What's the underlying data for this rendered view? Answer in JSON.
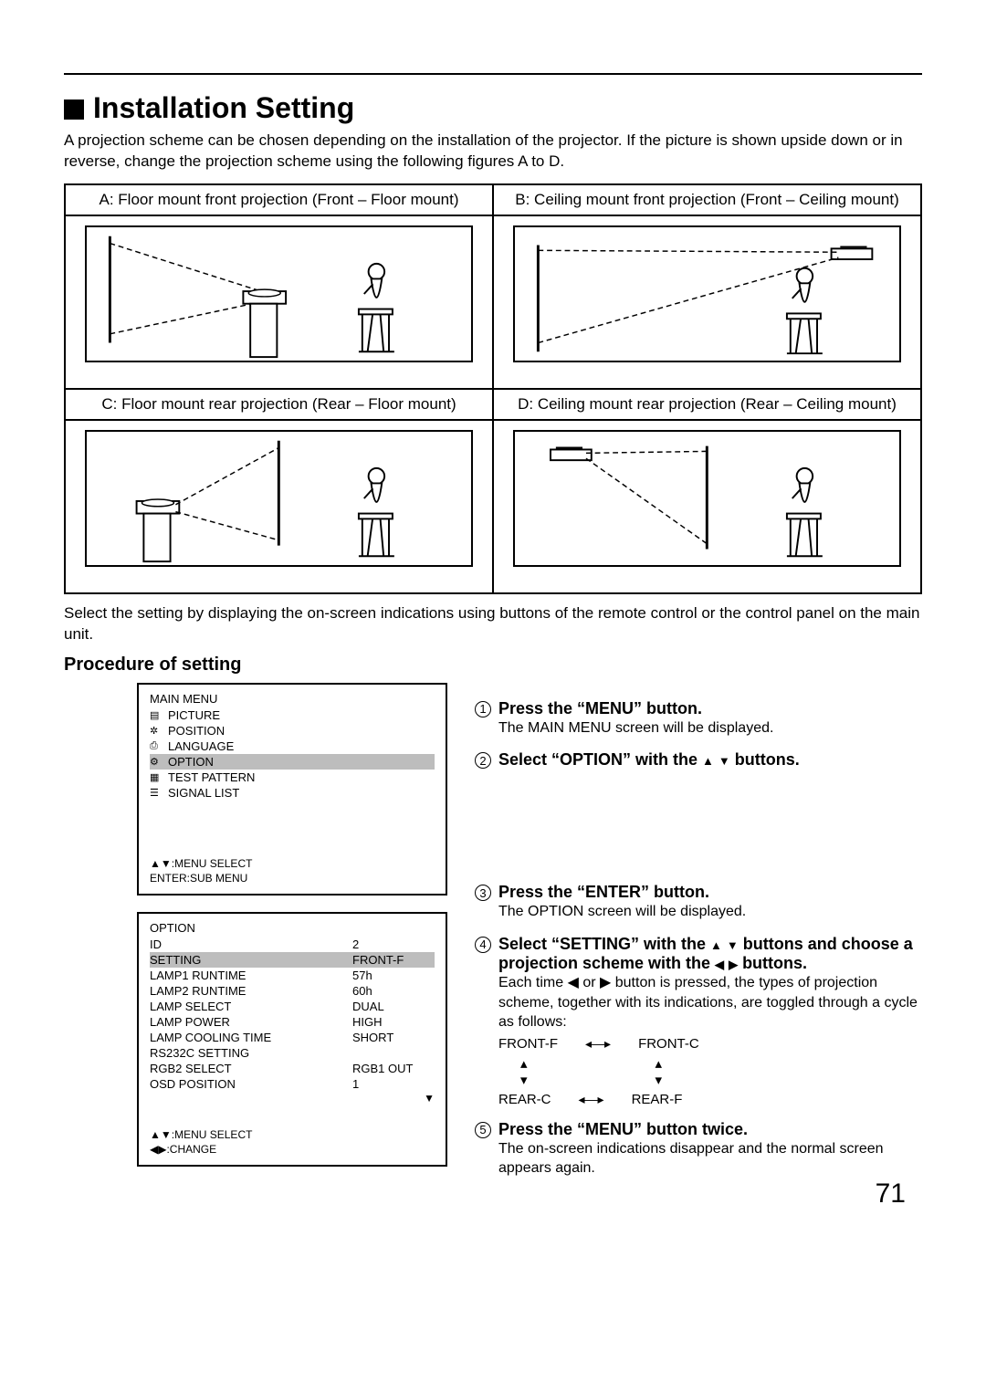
{
  "title": "Installation Setting",
  "intro": "A projection scheme can be chosen depending on the installation of the projector. If the picture is shown upside down or in reverse, change the projection scheme using the following figures A to D.",
  "schemes": {
    "a": "A: Floor mount front projection (Front – Floor mount)",
    "b": "B: Ceiling mount front projection (Front – Ceiling mount)",
    "c": "C: Floor mount rear projection (Rear – Floor mount)",
    "d": "D: Ceiling mount rear projection (Rear – Ceiling mount)"
  },
  "mid_text": "Select the setting by displaying the on-screen indications using buttons of the remote control or the control panel on the main unit.",
  "procedure_heading": "Procedure of setting",
  "osd1": {
    "title": "MAIN MENU",
    "items": [
      "PICTURE",
      "POSITION",
      "LANGUAGE",
      "OPTION",
      "TEST PATTERN",
      "SIGNAL LIST"
    ],
    "selected_index": 3,
    "foot1": "▲▼:MENU SELECT",
    "foot2": "ENTER:SUB MENU"
  },
  "osd2": {
    "title": "OPTION",
    "rows": [
      {
        "label": "ID",
        "value": "2"
      },
      {
        "label": "SETTING",
        "value": "FRONT-F",
        "sel": true
      },
      {
        "label": "LAMP1 RUNTIME",
        "value": "57h"
      },
      {
        "label": "LAMP2 RUNTIME",
        "value": "60h"
      },
      {
        "label": "LAMP SELECT",
        "value": "DUAL"
      },
      {
        "label": "LAMP POWER",
        "value": "HIGH"
      },
      {
        "label": "LAMP COOLING TIME",
        "value": "SHORT"
      },
      {
        "label": "RS232C SETTING",
        "value": ""
      },
      {
        "label": "RGB2 SELECT",
        "value": "RGB1 OUT"
      },
      {
        "label": "OSD POSITION",
        "value": "1"
      }
    ],
    "foot1": "▲▼:MENU SELECT",
    "foot2": "◀▶:CHANGE"
  },
  "steps": {
    "s1_head": "Press the “MENU” button.",
    "s1_body": "The MAIN MENU screen will be displayed.",
    "s2_head_a": "Select “OPTION” with the ",
    "s2_head_b": " buttons.",
    "s3_head": "Press the “ENTER” button.",
    "s3_body": "The OPTION screen will be displayed.",
    "s4_head_a": "Select “SETTING” with the ",
    "s4_head_b": " buttons and choose a projection scheme with the ",
    "s4_head_c": " buttons.",
    "s4_body": "Each time ◀ or ▶ button is pressed, the types of projection scheme, together with its indications, are toggled through a cycle as follows:",
    "cycle": {
      "a": "FRONT-F",
      "b": "FRONT-C",
      "c": "REAR-C",
      "d": "REAR-F"
    },
    "s5_head": "Press the “MENU” button twice.",
    "s5_body": "The on-screen indications disappear and the normal screen appears again."
  },
  "page_number": "71"
}
